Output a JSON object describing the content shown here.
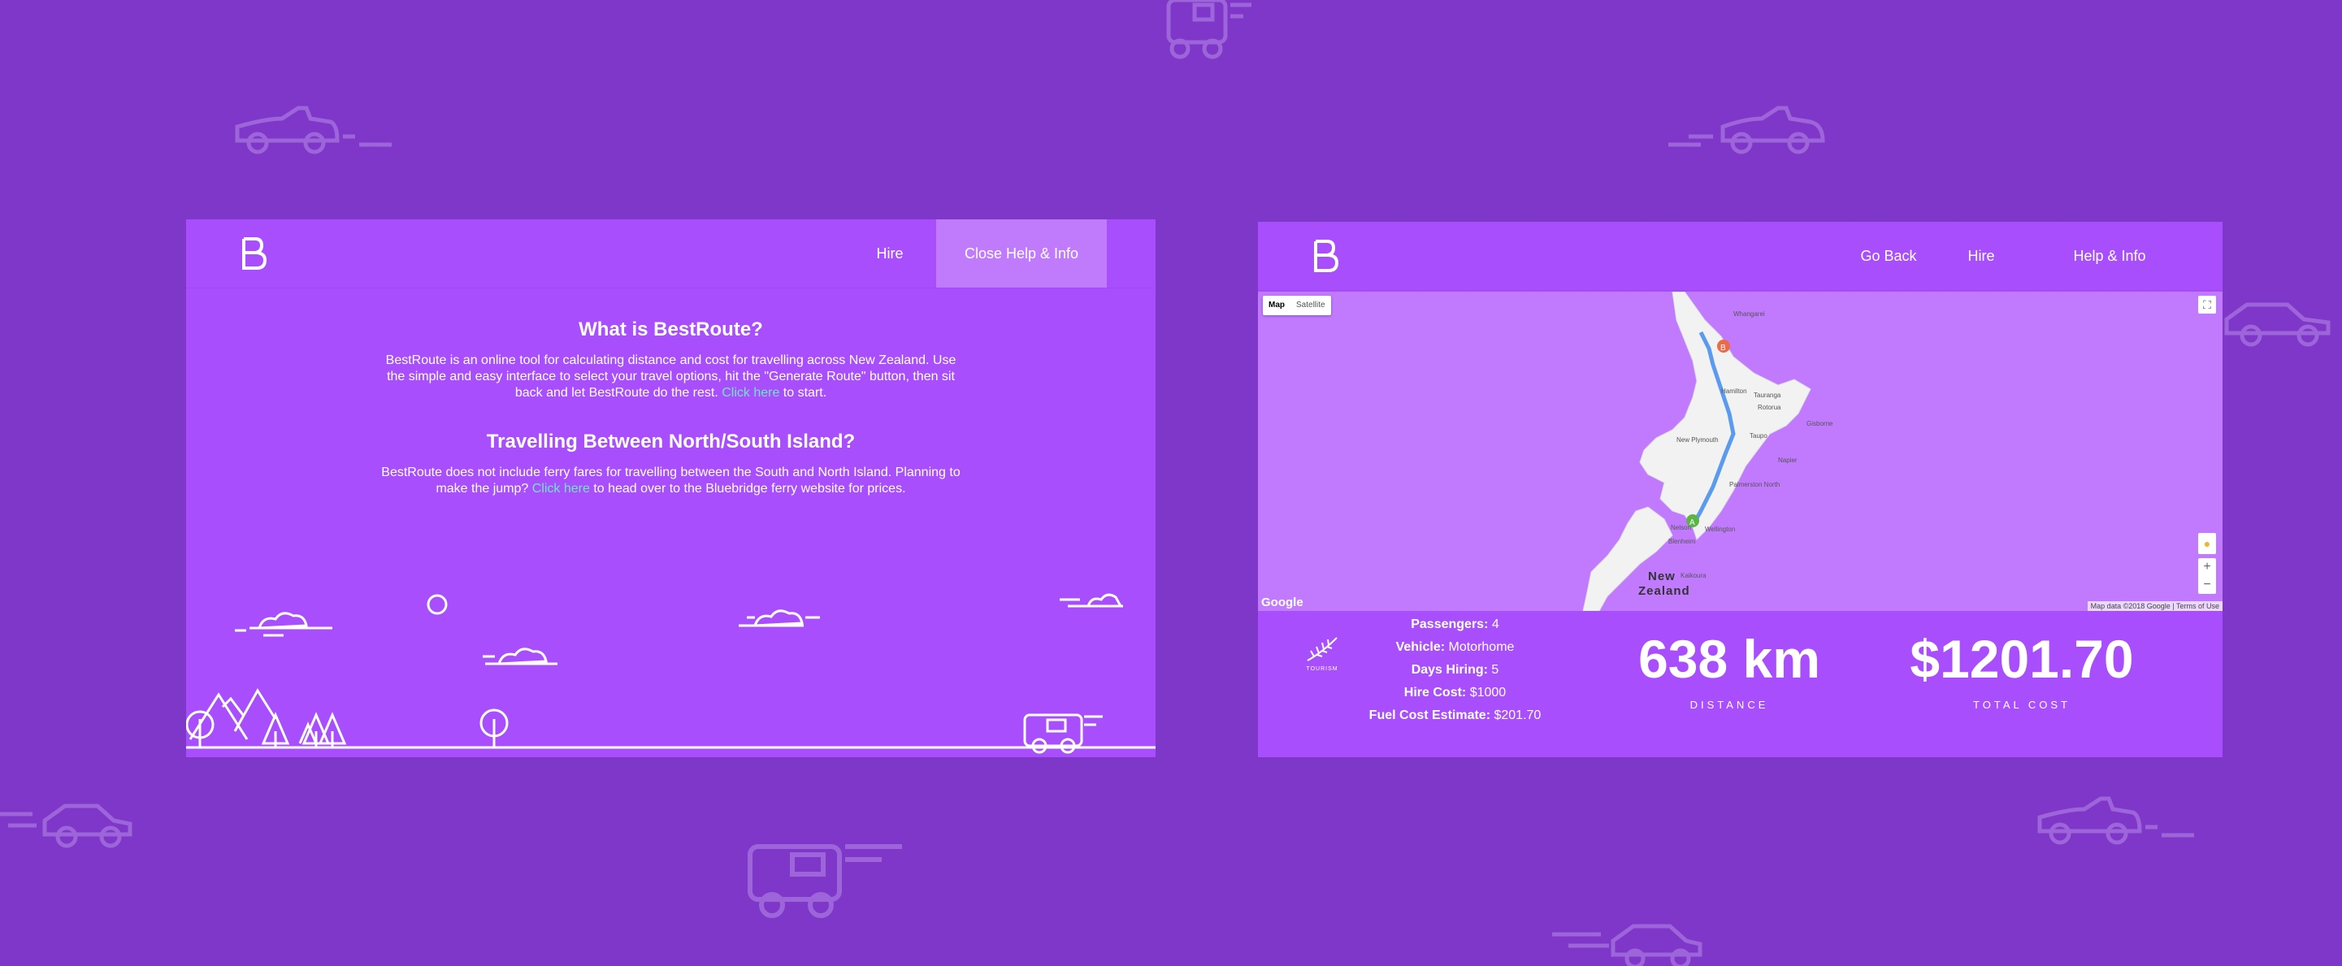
{
  "brand": {
    "logo_letter": "B"
  },
  "help_panel": {
    "nav": {
      "hire_label": "Hire",
      "close_help_label": "Close Help & Info"
    },
    "section1": {
      "heading": "What is BestRoute?",
      "text_before_link": "BestRoute is an online tool for calculating distance and cost for travelling across New Zealand. Use the simple and easy interface to select your travel options, hit the \"Generate Route\" button, then sit back and let BestRoute do the rest. ",
      "link_text": "Click here",
      "text_after_link": " to start."
    },
    "section2": {
      "heading": "Travelling Between North/South Island?",
      "text_before_link": "BestRoute does not include ferry fares for travelling between the South and North Island. Planning to make the jump? ",
      "link_text": "Click here",
      "text_after_link": " to head over to the Bluebridge ferry website for prices."
    }
  },
  "result_panel": {
    "nav": {
      "go_back_label": "Go Back",
      "hire_label": "Hire",
      "help_label": "Help & Info"
    },
    "map": {
      "map_button": "Map",
      "satellite_button": "Satellite",
      "google_label": "Google",
      "attribution": "Map data ©2018 Google",
      "terms": "Terms of Use",
      "zoom_in": "+",
      "zoom_out": "−",
      "marker_a": "A",
      "marker_b": "B",
      "country_label_line1": "New",
      "country_label_line2": "Zealand",
      "place_labels": [
        "Whangarei",
        "Hamilton",
        "Tauranga",
        "Rotorua",
        "Gisborne",
        "New Plymouth",
        "Taupo",
        "Napier",
        "Palmerston North",
        "Nelson",
        "Wellington",
        "Blenheim",
        "Kaikoura"
      ]
    },
    "logo_text": "TOURISM",
    "details": [
      {
        "label": "Passengers:",
        "value": " 4"
      },
      {
        "label": "Vehicle:",
        "value": " Motorhome"
      },
      {
        "label": "Days Hiring:",
        "value": " 5"
      },
      {
        "label": "Hire Cost:",
        "value": " $1000"
      },
      {
        "label": "Fuel Cost Estimate:",
        "value": " $201.70"
      }
    ],
    "distance": {
      "value": "638 km",
      "label": "DISTANCE"
    },
    "total": {
      "value": "$1201.70",
      "label": "TOTAL COST"
    }
  }
}
